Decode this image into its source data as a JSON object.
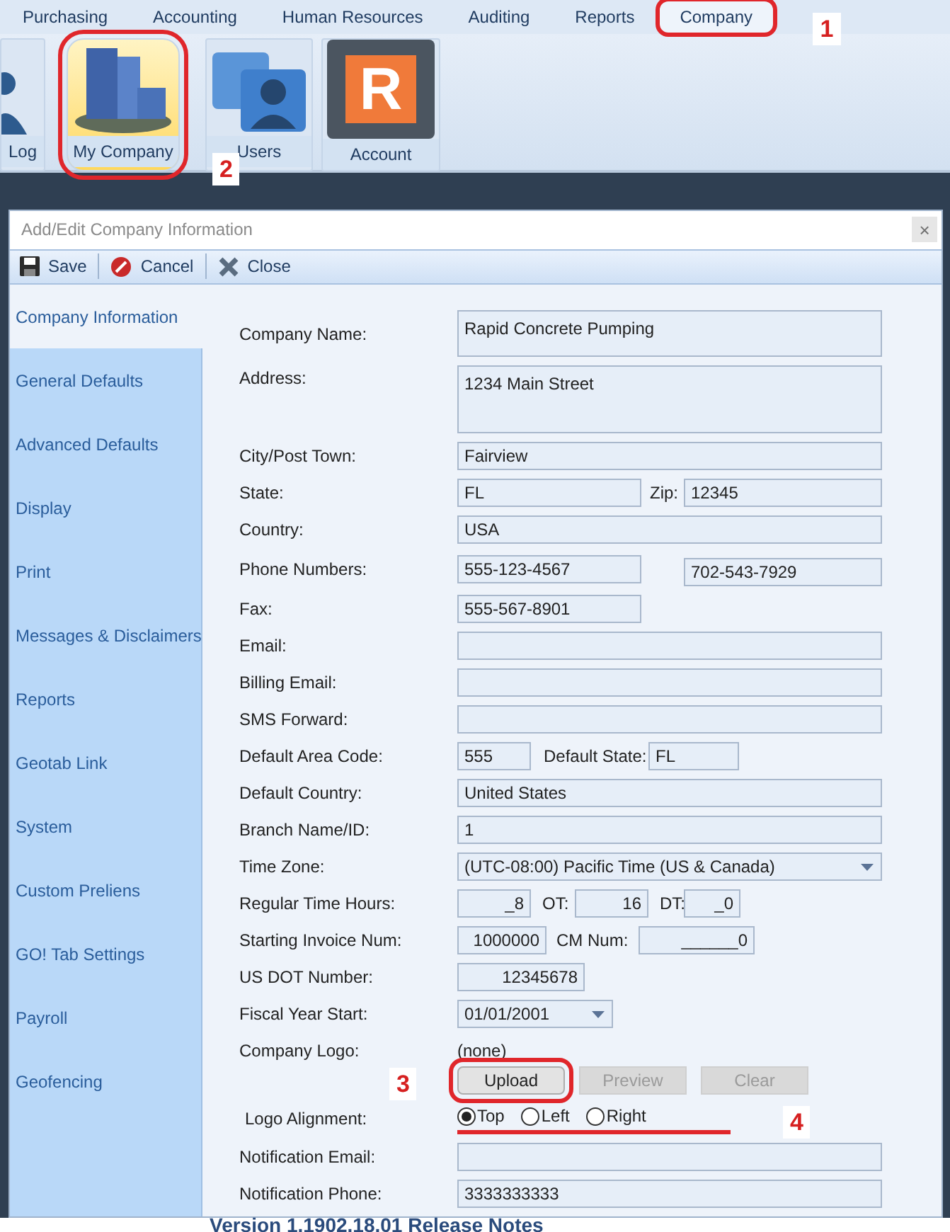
{
  "menu_tabs": [
    {
      "label": "Purchasing",
      "selected": false
    },
    {
      "label": "Accounting",
      "selected": false
    },
    {
      "label": "Human Resources",
      "selected": false
    },
    {
      "label": "Auditing",
      "selected": false
    },
    {
      "label": "Reports",
      "selected": false
    },
    {
      "label": "Company",
      "selected": true,
      "callout": "1"
    }
  ],
  "ribbon_buttons": [
    {
      "kind": "log",
      "label": "Log",
      "selected": false
    },
    {
      "kind": "company",
      "label": "My Company",
      "selected": true,
      "callout": "2"
    },
    {
      "kind": "users",
      "label": "Users",
      "selected": false
    },
    {
      "kind": "account",
      "label": "Account",
      "selected": false,
      "logo_letter": "R"
    }
  ],
  "dialog": {
    "title": "Add/Edit Company Information",
    "close_glyph": "×",
    "toolbar": [
      {
        "kind": "save",
        "label": "Save"
      },
      {
        "kind": "cancel",
        "label": "Cancel"
      },
      {
        "kind": "close",
        "label": "Close"
      }
    ],
    "sidebar": [
      {
        "label": "Company Information",
        "selected": true
      },
      {
        "label": "General Defaults",
        "selected": false
      },
      {
        "label": "Advanced Defaults",
        "selected": false
      },
      {
        "label": "Display",
        "selected": false
      },
      {
        "label": "Print",
        "selected": false
      },
      {
        "label": "Messages & Disclaimers",
        "selected": false
      },
      {
        "label": "Reports",
        "selected": false
      },
      {
        "label": "Geotab Link",
        "selected": false
      },
      {
        "label": "System",
        "selected": false
      },
      {
        "label": "Custom Preliens",
        "selected": false
      },
      {
        "label": "GO! Tab Settings",
        "selected": false
      },
      {
        "label": "Payroll",
        "selected": false
      },
      {
        "label": "Geofencing",
        "selected": false
      }
    ],
    "fields": [
      {
        "kind": "area",
        "label": "Company Name:",
        "value": "Rapid Concrete Pumping"
      },
      {
        "kind": "tall_area",
        "label": "Address:",
        "value": "1234 Main Street"
      },
      {
        "kind": "full",
        "label": "City/Post Town:",
        "value": "Fairview"
      },
      {
        "kind": "pair",
        "label": "State:",
        "value": "FL",
        "label_2": "Zip:",
        "value_2": "12345"
      },
      {
        "kind": "full",
        "label": "Country:",
        "value": "USA"
      },
      {
        "kind": "phones",
        "label": "Phone Numbers:",
        "value": "555-123-4567",
        "value_2": "702-543-7929"
      },
      {
        "kind": "half",
        "label": "Fax:",
        "value": "555-567-8901"
      },
      {
        "kind": "full",
        "label": "Email:"
      },
      {
        "kind": "full",
        "label": "Billing Email:"
      },
      {
        "kind": "full",
        "label": "SMS Forward:"
      },
      {
        "kind": "area_code",
        "label": "Default Area Code:",
        "value": "555",
        "label_2": "Default State:",
        "value_2": "FL"
      },
      {
        "kind": "full",
        "label": "Default Country:",
        "value": "United States"
      },
      {
        "kind": "full",
        "label": "Branch Name/ID:",
        "value": "1"
      },
      {
        "kind": "select",
        "label": "Time Zone:",
        "value": "(UTC-08:00) Pacific Time (US & Canada)"
      },
      {
        "kind": "hours",
        "label": "Regular Time Hours:",
        "value": "_8",
        "label_2": "OT:",
        "value_2": "16",
        "label_3": "DT:",
        "value_3": "_0"
      },
      {
        "kind": "invoice",
        "label": "Starting Invoice Num:",
        "value": "1000000",
        "label_2": "CM Num:",
        "value_2": "______0"
      },
      {
        "kind": "number",
        "label": "US DOT Number:",
        "value": "12345678"
      },
      {
        "kind": "date",
        "label": "Fiscal Year Start:",
        "value": "01/01/2001"
      },
      {
        "kind": "logo",
        "label": "Company Logo:",
        "value": "(none)",
        "buttons": [
          {
            "label": "Upload",
            "disabled": false,
            "callout": "3"
          },
          {
            "label": "Preview",
            "disabled": true
          },
          {
            "label": "Clear",
            "disabled": true
          }
        ]
      },
      {
        "kind": "radios",
        "label": "Logo Alignment:",
        "callout": "4",
        "options": [
          {
            "label": "Top",
            "selected": true
          },
          {
            "label": "Left",
            "selected": false
          },
          {
            "label": "Right",
            "selected": false
          }
        ]
      },
      {
        "kind": "full",
        "label": "Notification Email:"
      },
      {
        "kind": "full",
        "label": "Notification Phone:",
        "value": "3333333333"
      }
    ]
  },
  "background_text": "Version 1.1902.18.01 Release Notes"
}
